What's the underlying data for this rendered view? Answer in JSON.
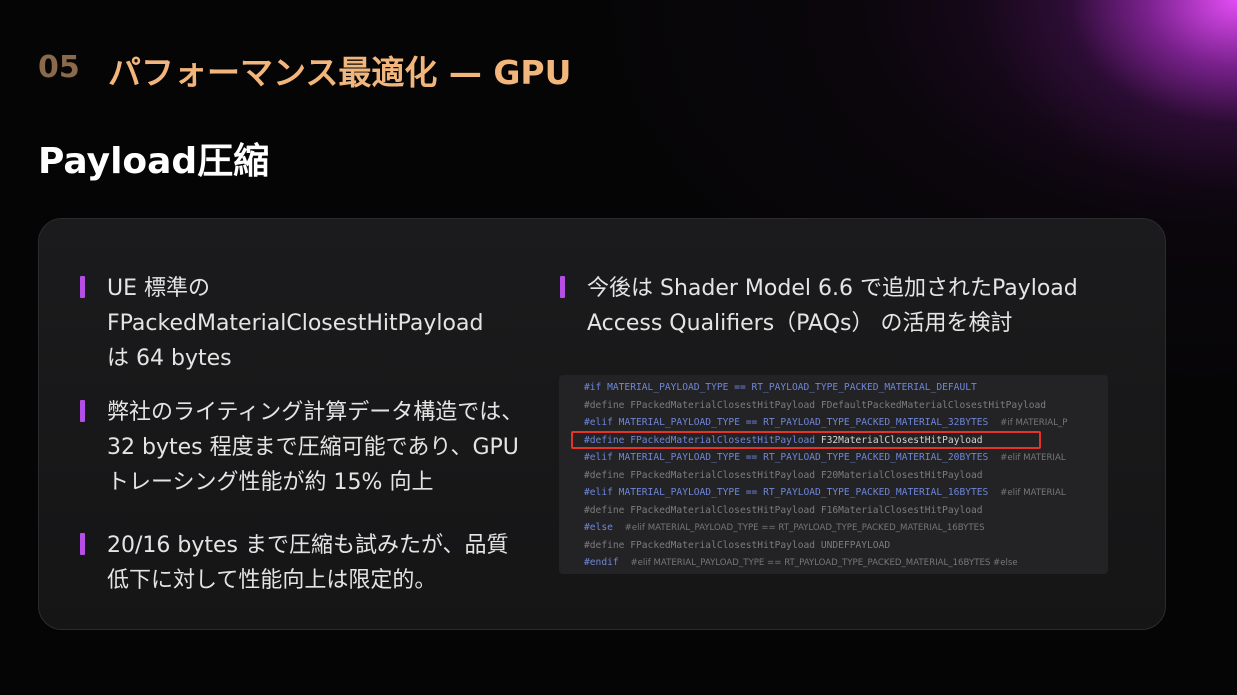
{
  "header": {
    "section_number": "05",
    "section_title": "パフォーマンス最適化 — GPU"
  },
  "subtitle": "Payload圧縮",
  "left_bullets": [
    {
      "lines": [
        "UE 標準の",
        "FPackedMaterialClosestHitPayload",
        "は 64 bytes"
      ]
    },
    {
      "lines": [
        "弊社のライティング計算データ構造では、",
        "32 bytes 程度まで圧縮可能であり、GPU",
        "トレーシング性能が約 15% 向上"
      ]
    },
    {
      "lines": [
        "20/16 bytes まで圧縮も試みたが、品質",
        "低下に対して性能向上は限定的。"
      ]
    }
  ],
  "right_bullet": {
    "lines": [
      "今後は Shader Model 6.6 で追加されたPayload",
      "Access Qualifiers（PAQs） の活用を検討"
    ]
  },
  "code": {
    "lines": [
      {
        "kw": "#if",
        "macro": "MATERIAL_PAYLOAD_TYPE == RT_PAYLOAD_TYPE_PACKED_MATERIAL_DEFAULT",
        "hint": ""
      },
      {
        "kw": "#define",
        "macro": "FPackedMaterialClosestHitPayload FDefaultPackedMaterialClosestHitPayload",
        "hint": ""
      },
      {
        "kw": "#elif",
        "macro": "MATERIAL_PAYLOAD_TYPE == RT_PAYLOAD_TYPE_PACKED_MATERIAL_32BYTES",
        "hint": "#if MATERIAL_P"
      },
      {
        "kw": "#define",
        "macro": "FPackedMaterialClosestHitPayload",
        "value": "F32MaterialClosestHitPayload",
        "hint": ""
      },
      {
        "kw": "#elif",
        "macro": "MATERIAL_PAYLOAD_TYPE == RT_PAYLOAD_TYPE_PACKED_MATERIAL_20BYTES",
        "hint": "#elif MATERIAL"
      },
      {
        "kw": "#define",
        "macro": "FPackedMaterialClosestHitPayload F20MaterialClosestHitPayload",
        "hint": ""
      },
      {
        "kw": "#elif",
        "macro": "MATERIAL_PAYLOAD_TYPE == RT_PAYLOAD_TYPE_PACKED_MATERIAL_16BYTES",
        "hint": "#elif MATERIAL"
      },
      {
        "kw": "#define",
        "macro": "FPackedMaterialClosestHitPayload F16MaterialClosestHitPayload",
        "hint": ""
      },
      {
        "kw": "#else",
        "macro": "",
        "hint": "#elif MATERIAL_PAYLOAD_TYPE == RT_PAYLOAD_TYPE_PACKED_MATERIAL_16BYTES"
      },
      {
        "kw": "#define",
        "macro": "FPackedMaterialClosestHitPayload UNDEFPAYLOAD",
        "hint": ""
      },
      {
        "kw": "#endif",
        "macro": "",
        "hint": "#elif MATERIAL_PAYLOAD_TYPE == RT_PAYLOAD_TYPE_PACKED_MATERIAL_16BYTES #else"
      }
    ]
  },
  "colors": {
    "accent_bar": "#b44ee6",
    "section_title": "#f2b67c",
    "highlight_box": "#e53327"
  }
}
